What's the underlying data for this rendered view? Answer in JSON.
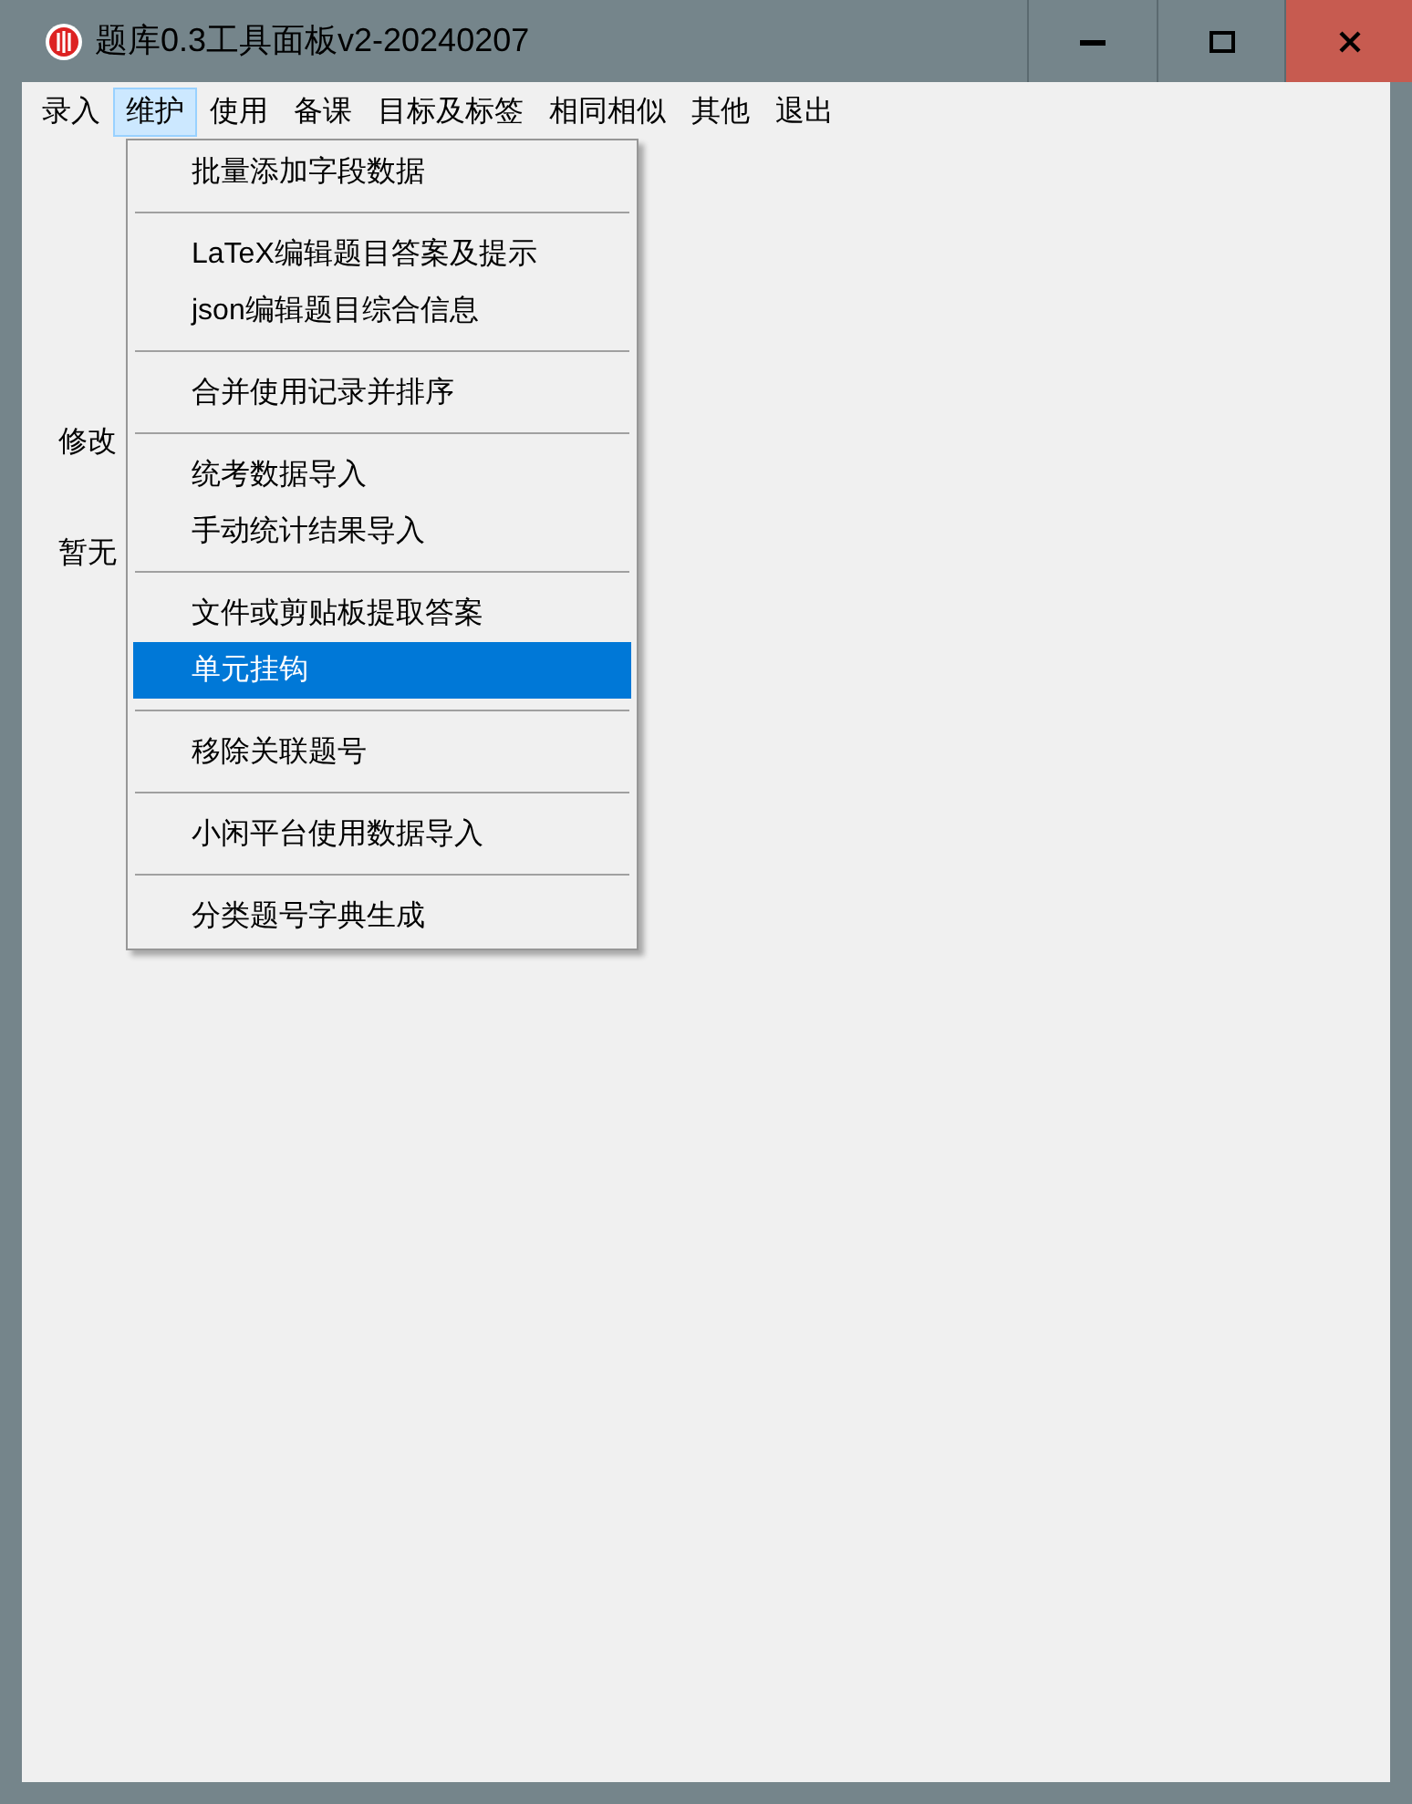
{
  "window": {
    "title": "题库0.3工具面板v2-20240207",
    "controls": [
      {
        "kind": "minimize"
      },
      {
        "kind": "maximize"
      },
      {
        "kind": "close"
      }
    ]
  },
  "menu_bar": [
    {
      "label": "录入",
      "selected": false
    },
    {
      "label": "维护",
      "selected": true
    },
    {
      "label": "使用",
      "selected": false
    },
    {
      "label": "备课",
      "selected": false
    },
    {
      "label": "目标及标签",
      "selected": false
    },
    {
      "label": "相同相似",
      "selected": false
    },
    {
      "label": "其他",
      "selected": false
    },
    {
      "label": "退出",
      "selected": false
    }
  ],
  "dropdown": [
    {
      "kind": "item",
      "label": "批量添加字段数据",
      "selected": false
    },
    {
      "kind": "separator"
    },
    {
      "kind": "item",
      "label": "LaTeX编辑题目答案及提示",
      "selected": false
    },
    {
      "kind": "item",
      "label": "json编辑题目综合信息",
      "selected": false
    },
    {
      "kind": "separator"
    },
    {
      "kind": "item",
      "label": "合并使用记录并排序",
      "selected": false
    },
    {
      "kind": "separator"
    },
    {
      "kind": "item",
      "label": "统考数据导入",
      "selected": false
    },
    {
      "kind": "item",
      "label": "手动统计结果导入",
      "selected": false
    },
    {
      "kind": "separator"
    },
    {
      "kind": "item",
      "label": "文件或剪贴板提取答案",
      "selected": false
    },
    {
      "kind": "item",
      "label": "单元挂钩",
      "selected": true
    },
    {
      "kind": "separator"
    },
    {
      "kind": "item",
      "label": "移除关联题号",
      "selected": false
    },
    {
      "kind": "separator"
    },
    {
      "kind": "item",
      "label": "小闲平台使用数据导入",
      "selected": false
    },
    {
      "kind": "separator"
    },
    {
      "kind": "item",
      "label": "分类题号字典生成",
      "selected": false
    }
  ],
  "labels": [
    "修改",
    "暂无"
  ]
}
